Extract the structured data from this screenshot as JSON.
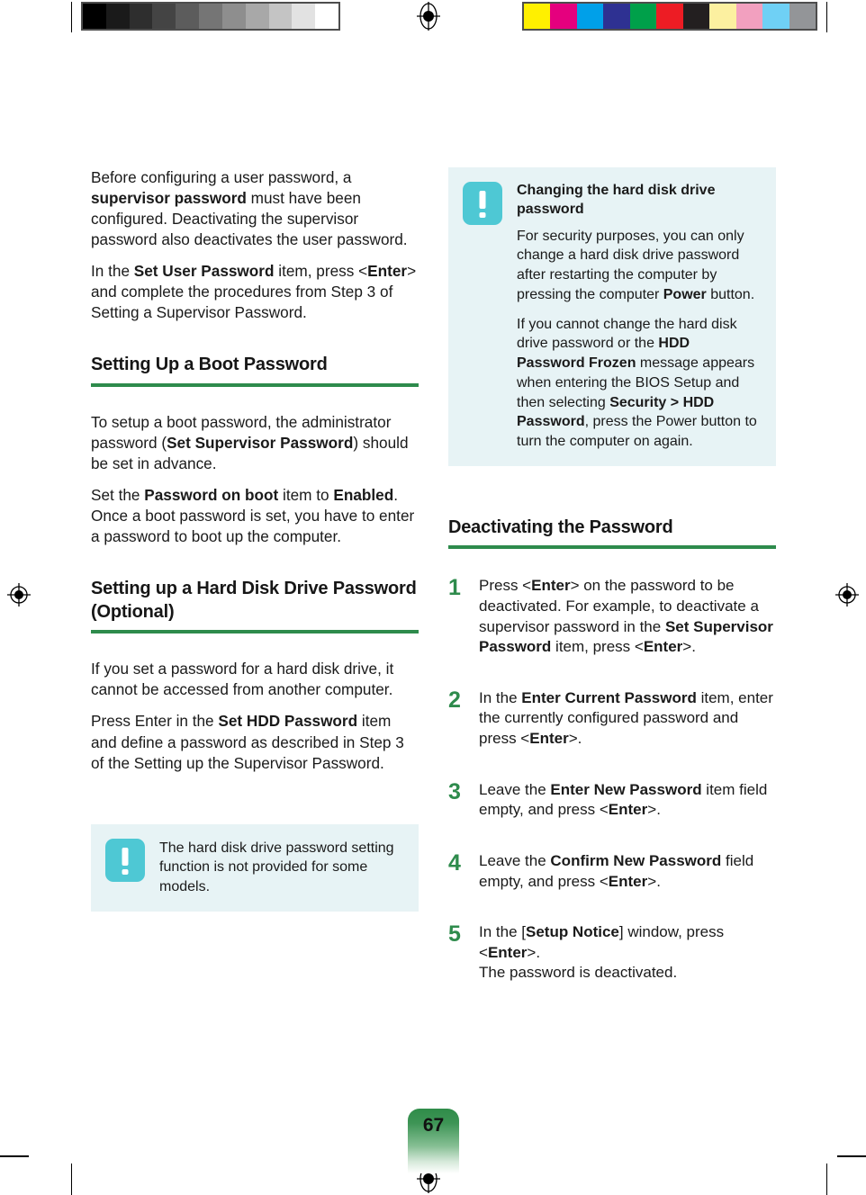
{
  "page": {
    "number": "67",
    "accent_green": "#2e8b4c",
    "note_background": "#e7f3f5",
    "note_icon_color": "#4ec8d4"
  },
  "prepress": {
    "grayscale_swatches": [
      "#000000",
      "#1a1a1a",
      "#2e2e2e",
      "#444444",
      "#5c5c5c",
      "#757575",
      "#8e8e8e",
      "#a8a8a8",
      "#c4c4c4",
      "#e2e2e2",
      "#ffffff"
    ],
    "color_swatches": [
      "#fff000",
      "#e5007e",
      "#00a0e9",
      "#2e3192",
      "#00a04a",
      "#ed1c24",
      "#231f20",
      "#fcf0a0",
      "#f2a0bf",
      "#6fd0f5",
      "#939598"
    ],
    "registration_icon": "registration-target-icon"
  },
  "left_column": {
    "intro_paragraphs": [
      {
        "runs": [
          {
            "text": "Before configuring a user password, a ",
            "bold": false
          },
          {
            "text": "supervisor password",
            "bold": true
          },
          {
            "text": " must have been configured. Deactivating the supervisor password also deactivates the user password.",
            "bold": false
          }
        ]
      },
      {
        "runs": [
          {
            "text": "In the ",
            "bold": false
          },
          {
            "text": "Set User Password",
            "bold": true
          },
          {
            "text": " item, press <",
            "bold": false
          },
          {
            "text": "Enter",
            "bold": true
          },
          {
            "text": "> and complete the procedures from Step 3 of Setting a Supervisor Password.",
            "bold": false
          }
        ]
      }
    ],
    "section_boot": {
      "heading": "Setting Up a Boot Password",
      "paragraphs": [
        {
          "runs": [
            {
              "text": "To setup a boot password, the administrator password (",
              "bold": false
            },
            {
              "text": "Set Supervisor Password",
              "bold": true
            },
            {
              "text": ") should be set in advance.",
              "bold": false
            }
          ]
        },
        {
          "runs": [
            {
              "text": "Set the ",
              "bold": false
            },
            {
              "text": "Password on boot",
              "bold": true
            },
            {
              "text": " item to ",
              "bold": false
            },
            {
              "text": "Enabled",
              "bold": true
            },
            {
              "text": ". Once a boot password is set, you have to enter a password to boot up the computer.",
              "bold": false
            }
          ]
        }
      ]
    },
    "section_hdd": {
      "heading": "Setting up a Hard Disk Drive Password (Optional)",
      "paragraphs": [
        {
          "runs": [
            {
              "text": "If you set a password for a hard disk drive, it cannot be accessed from another computer.",
              "bold": false
            }
          ]
        },
        {
          "runs": [
            {
              "text": "Press Enter in the ",
              "bold": false
            },
            {
              "text": "Set HDD Password",
              "bold": true
            },
            {
              "text": " item and define a password as described in Step 3 of the Setting up the Supervisor Password.",
              "bold": false
            }
          ]
        }
      ]
    },
    "note": {
      "icon": "exclamation-icon",
      "title": "",
      "paragraphs": [
        {
          "runs": [
            {
              "text": "The hard disk drive password setting function is not provided for some models.",
              "bold": false
            }
          ]
        }
      ]
    }
  },
  "right_column": {
    "note": {
      "icon": "exclamation-icon",
      "title": "Changing the hard disk drive password",
      "paragraphs": [
        {
          "runs": [
            {
              "text": "For security purposes, you can only change a hard disk drive password after restarting the computer by pressing the computer ",
              "bold": false
            },
            {
              "text": "Power",
              "bold": true
            },
            {
              "text": " button.",
              "bold": false
            }
          ]
        },
        {
          "runs": [
            {
              "text": "If you cannot change the hard disk drive password or the ",
              "bold": false
            },
            {
              "text": "HDD Password Frozen",
              "bold": true
            },
            {
              "text": " message appears when entering the BIOS Setup and then selecting ",
              "bold": false
            },
            {
              "text": "Security > HDD Password",
              "bold": true
            },
            {
              "text": ", press the Power button to turn the computer on again.",
              "bold": false
            }
          ]
        }
      ]
    },
    "section_deactivating": {
      "heading": "Deactivating the Password",
      "steps": [
        {
          "number": "1",
          "runs": [
            {
              "text": "Press <",
              "bold": false
            },
            {
              "text": "Enter",
              "bold": true
            },
            {
              "text": "> on the password to be deactivated. For example, to deactivate a supervisor password in the ",
              "bold": false
            },
            {
              "text": "Set Supervisor Password",
              "bold": true
            },
            {
              "text": " item, press <",
              "bold": false
            },
            {
              "text": "Enter",
              "bold": true
            },
            {
              "text": ">.",
              "bold": false
            }
          ]
        },
        {
          "number": "2",
          "runs": [
            {
              "text": "In the ",
              "bold": false
            },
            {
              "text": "Enter Current Password",
              "bold": true
            },
            {
              "text": " item, enter the currently configured password and press <",
              "bold": false
            },
            {
              "text": "Enter",
              "bold": true
            },
            {
              "text": ">.",
              "bold": false
            }
          ]
        },
        {
          "number": "3",
          "runs": [
            {
              "text": "Leave the ",
              "bold": false
            },
            {
              "text": "Enter New Password",
              "bold": true
            },
            {
              "text": " item field empty, and press <",
              "bold": false
            },
            {
              "text": "Enter",
              "bold": true
            },
            {
              "text": ">.",
              "bold": false
            }
          ]
        },
        {
          "number": "4",
          "runs": [
            {
              "text": "Leave the ",
              "bold": false
            },
            {
              "text": "Confirm New Password",
              "bold": true
            },
            {
              "text": " field empty, and press <",
              "bold": false
            },
            {
              "text": "Enter",
              "bold": true
            },
            {
              "text": ">.",
              "bold": false
            }
          ]
        },
        {
          "number": "5",
          "runs": [
            {
              "text": "In the [",
              "bold": false
            },
            {
              "text": "Setup Notice",
              "bold": true
            },
            {
              "text": "] window, press <",
              "bold": false
            },
            {
              "text": "Enter",
              "bold": true
            },
            {
              "text": ">.\nThe password is deactivated.",
              "bold": false
            }
          ]
        }
      ]
    }
  }
}
